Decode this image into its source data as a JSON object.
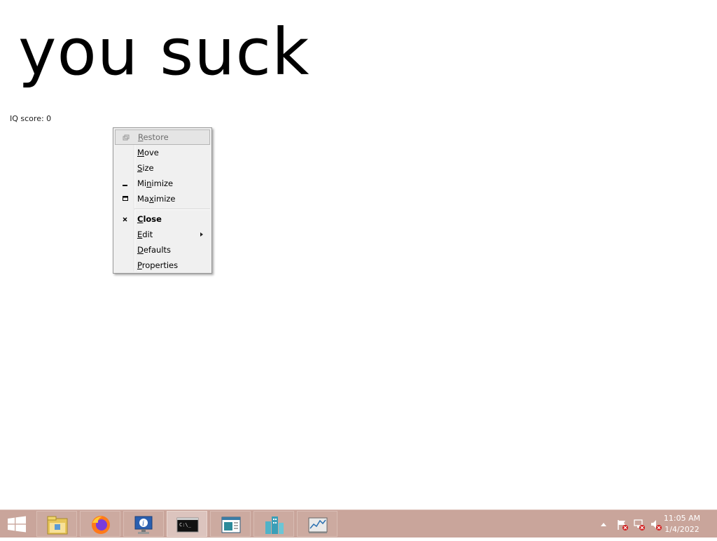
{
  "desktop": {
    "big_text": "you suck",
    "iq_label": "IQ score: 0"
  },
  "system_menu": {
    "items": [
      {
        "label": "Restore",
        "accel": "R",
        "icon": "restore-icon",
        "disabled": true
      },
      {
        "label": "Move",
        "accel": "M",
        "icon": "",
        "disabled": false
      },
      {
        "label": "Size",
        "accel": "S",
        "icon": "",
        "disabled": false
      },
      {
        "label": "Minimize",
        "accel": "n",
        "icon": "minimize-icon",
        "disabled": false
      },
      {
        "label": "Maximize",
        "accel": "x",
        "icon": "maximize-icon",
        "disabled": false
      },
      {
        "label": "Close",
        "accel": "C",
        "icon": "close-icon",
        "disabled": false,
        "bold": true
      },
      {
        "label": "Edit",
        "accel": "E",
        "icon": "",
        "submenu": true
      },
      {
        "label": "Defaults",
        "accel": "D",
        "icon": ""
      },
      {
        "label": "Properties",
        "accel": "P",
        "icon": ""
      }
    ]
  },
  "taskbar": {
    "color": "#c9a59b",
    "pinned": [
      {
        "name": "file-explorer-icon"
      },
      {
        "name": "firefox-icon"
      },
      {
        "name": "system-information-icon"
      },
      {
        "name": "command-prompt-icon",
        "active": true
      },
      {
        "name": "notepad-icon"
      },
      {
        "name": "city-buildings-icon"
      },
      {
        "name": "performance-monitor-icon"
      }
    ],
    "clock": {
      "time": "11:05 AM",
      "date": "1/4/2022"
    }
  }
}
